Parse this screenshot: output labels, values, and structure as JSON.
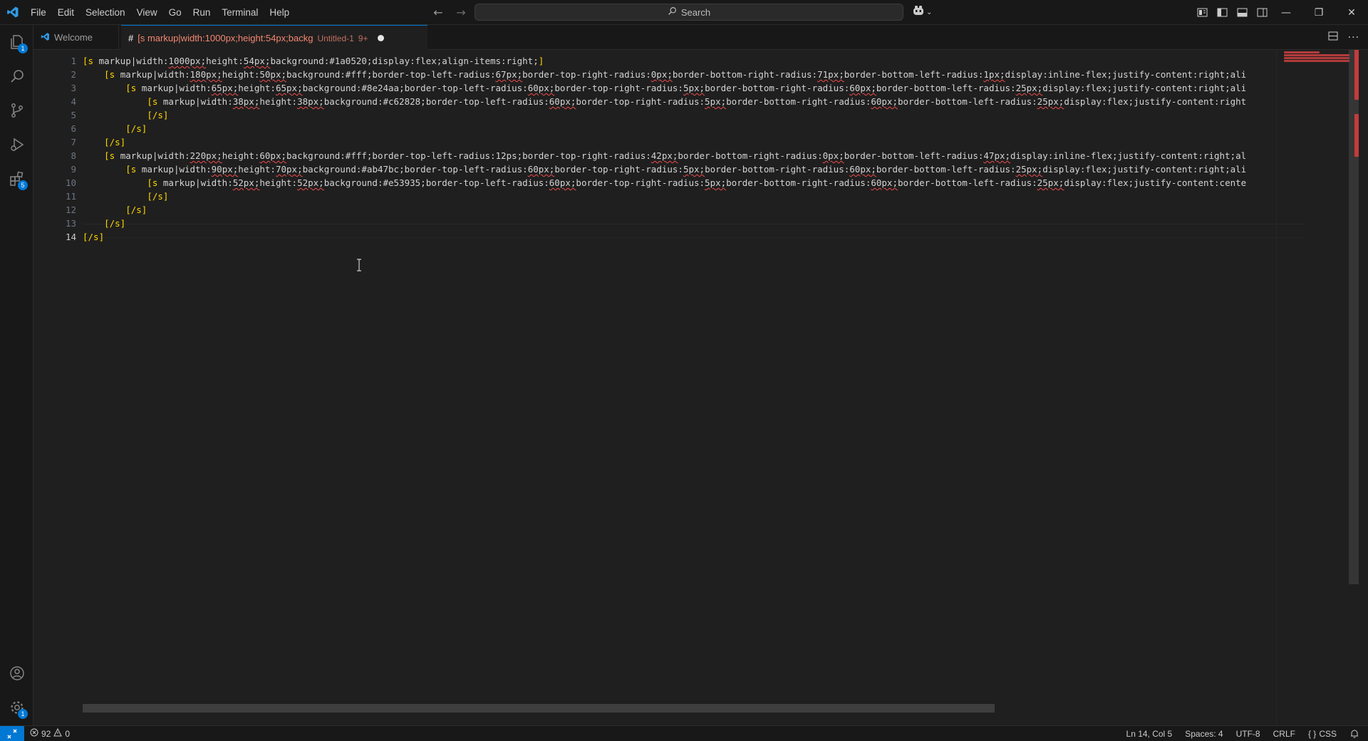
{
  "menu": [
    "File",
    "Edit",
    "Selection",
    "View",
    "Go",
    "Run",
    "Terminal",
    "Help"
  ],
  "search": {
    "label": "Search"
  },
  "activity": {
    "explorer_badge": "1",
    "extensions_badge": "5",
    "manage_badge": "1"
  },
  "tabs": {
    "welcome": "Welcome",
    "active": {
      "title": "[s markup|width:1000px;height:54px;backg",
      "description": "Untitled-1",
      "problems": "9+"
    }
  },
  "editor": {
    "line_numbers": [
      "1",
      "2",
      "3",
      "4",
      "5",
      "6",
      "7",
      "8",
      "9",
      "10",
      "11",
      "12",
      "13",
      "14"
    ],
    "lines": [
      "[s markup|width:1000px;height:54px;background:#1a0520;display:flex;align-items:right;]",
      "    [s markup|width:180px;height:50px;background:#fff;border-top-left-radius:67px;border-top-right-radius:0px;border-bottom-right-radius:71px;border-bottom-left-radius:1px;display:inline-flex;justify-content:right;ali",
      "        [s markup|width:65px;height:65px;background:#8e24aa;border-top-left-radius:60px;border-top-right-radius:5px;border-bottom-right-radius:60px;border-bottom-left-radius:25px;display:flex;justify-content:right;ali",
      "            [s markup|width:38px;height:38px;background:#c62828;border-top-left-radius:60px;border-top-right-radius:5px;border-bottom-right-radius:60px;border-bottom-left-radius:25px;display:flex;justify-content:right",
      "            [/s]",
      "        [/s]",
      "    [/s]",
      "    [s markup|width:220px;height:60px;background:#fff;border-top-left-radius:12ps;border-top-right-radius:42px;border-bottom-right-radius:0px;border-bottom-left-radius:47px;display:inline-flex;justify-content:right;al",
      "        [s markup|width:90px;height:70px;background:#ab47bc;border-top-left-radius:60px;border-top-right-radius:5px;border-bottom-right-radius:60px;border-bottom-left-radius:25px;display:flex;justify-content:right;ali",
      "            [s markup|width:52px;height:52px;background:#e53935;border-top-left-radius:60px;border-top-right-radius:5px;border-bottom-right-radius:60px;border-bottom-left-radius:25px;display:flex;justify-content:cente",
      "            [/s]",
      "        [/s]",
      "    [/s]",
      "[/s]"
    ]
  },
  "status": {
    "errors": "92",
    "warnings": "0",
    "position": "Ln 14, Col 5",
    "spaces": "Spaces: 4",
    "encoding": "UTF-8",
    "eol": "CRLF",
    "language": "CSS"
  },
  "colors": {
    "accent": "#0078d4",
    "error": "#f14c4c",
    "bracket": "#ffd700"
  }
}
